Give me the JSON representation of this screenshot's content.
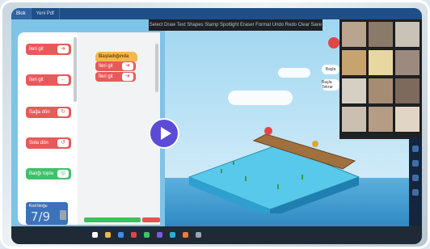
{
  "window": {
    "tabs": [
      "Blok",
      "Yeni Pdf"
    ]
  },
  "palette": {
    "blocks": [
      "İleri git",
      "İleri git",
      "Sağa dön",
      "Sola dön",
      "Balığı topla"
    ]
  },
  "workspace": {
    "start_label": "Başladığında",
    "blocks": [
      "İleri git",
      "İleri git"
    ]
  },
  "counter": {
    "label": "Kod bloğu",
    "value": "7/9"
  },
  "toolbar": {
    "tools": [
      "Select",
      "Draw",
      "Text",
      "Shapes",
      "Stamp",
      "Spotlight",
      "Eraser",
      "Format",
      "Undo",
      "Redo",
      "Clear",
      "Save"
    ]
  },
  "bubbles": {
    "b1": "Başla",
    "b2": "Başla Tekrar"
  },
  "colors": {
    "accent": "#5b4bd6",
    "block_red": "#e85a5a",
    "block_green": "#41c06a",
    "start_yellow": "#f2b84b"
  },
  "icons": [
    "play-icon",
    "arrow-right-icon",
    "trash-icon",
    "record-icon"
  ]
}
